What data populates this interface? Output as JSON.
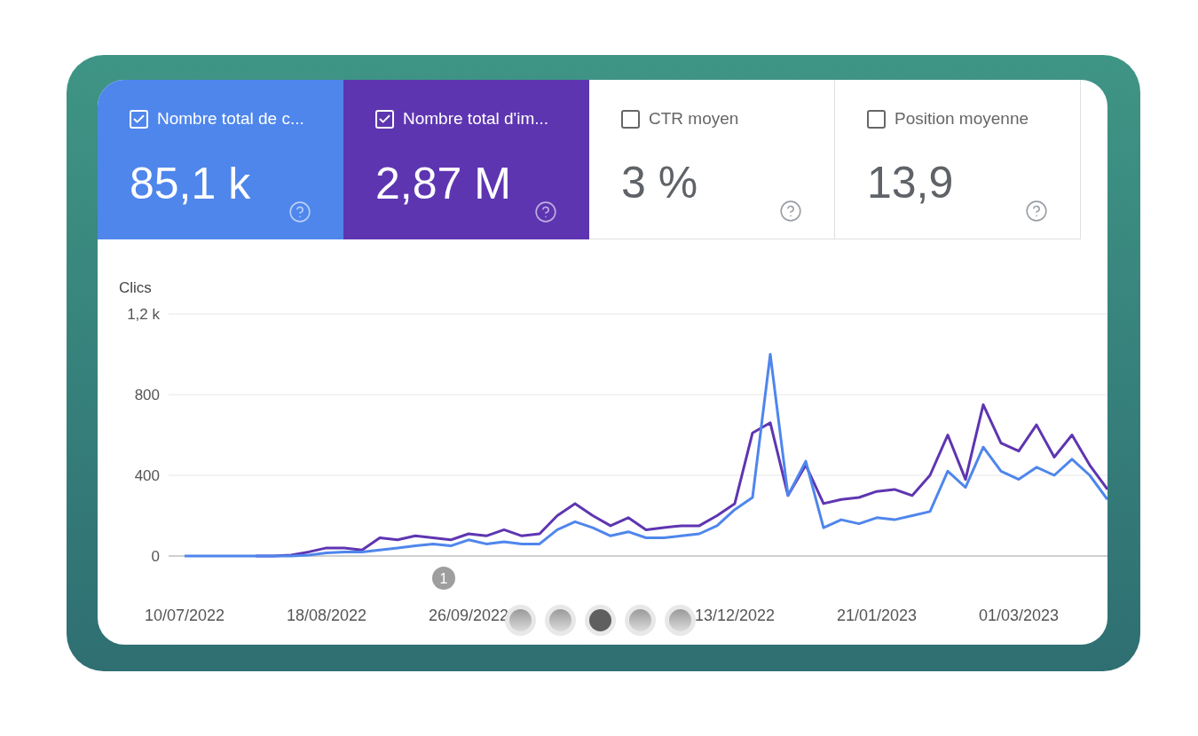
{
  "metrics": [
    {
      "label": "Nombre total de c...",
      "value": "85,1 k",
      "checked": true,
      "color": "#4f86ec"
    },
    {
      "label": "Nombre total d'im...",
      "value": "2,87 M",
      "checked": true,
      "color": "#5e35b1"
    },
    {
      "label": "CTR moyen",
      "value": "3 %",
      "checked": false
    },
    {
      "label": "Position moyenne",
      "value": "13,9",
      "checked": false
    }
  ],
  "chart": {
    "chart_data": {
      "type": "line",
      "ylabel": "Clics",
      "categories": [
        "10/07/2022",
        null,
        null,
        null,
        null,
        null,
        null,
        null,
        "18/08/2022",
        null,
        null,
        null,
        null,
        null,
        null,
        null,
        "26/09/2022",
        null,
        null,
        null,
        null,
        null,
        null,
        null,
        null,
        null,
        null,
        null,
        null,
        null,
        null,
        "13/12/2022",
        null,
        null,
        null,
        null,
        null,
        null,
        null,
        "21/01/2023",
        null,
        null,
        null,
        null,
        null,
        null,
        null,
        "01/03/2023",
        null,
        null,
        null,
        null,
        null
      ],
      "series": [
        {
          "color": "#4f86ec",
          "values": [
            0,
            0,
            0,
            0,
            0,
            0,
            0,
            5,
            15,
            20,
            20,
            30,
            40,
            50,
            60,
            50,
            80,
            60,
            70,
            60,
            60,
            130,
            170,
            140,
            100,
            120,
            90,
            90,
            100,
            110,
            150,
            230,
            290,
            1000,
            300,
            470,
            140,
            180,
            160,
            190,
            180,
            200,
            220,
            420,
            340,
            540,
            420,
            380,
            440,
            400,
            480,
            400,
            280
          ]
        },
        {
          "color": "#5e35b1",
          "values": [
            null,
            null,
            null,
            null,
            0,
            0,
            5,
            20,
            40,
            40,
            30,
            90,
            80,
            100,
            90,
            80,
            110,
            100,
            130,
            100,
            110,
            200,
            260,
            200,
            150,
            190,
            130,
            140,
            150,
            150,
            200,
            260,
            610,
            660,
            300,
            450,
            260,
            280,
            290,
            320,
            330,
            300,
            400,
            600,
            380,
            750,
            560,
            520,
            650,
            490,
            600,
            450,
            330
          ]
        }
      ],
      "ylim": [
        0,
        1200
      ],
      "yticks": [
        0,
        400,
        800,
        {
          "value": 1200,
          "label": "1,2 k"
        }
      ],
      "annotations": [
        "1"
      ]
    }
  },
  "carousel": {
    "dots": [
      {
        "selected": false
      },
      {
        "selected": false
      },
      {
        "selected": true
      },
      {
        "selected": false
      },
      {
        "selected": false
      }
    ]
  }
}
